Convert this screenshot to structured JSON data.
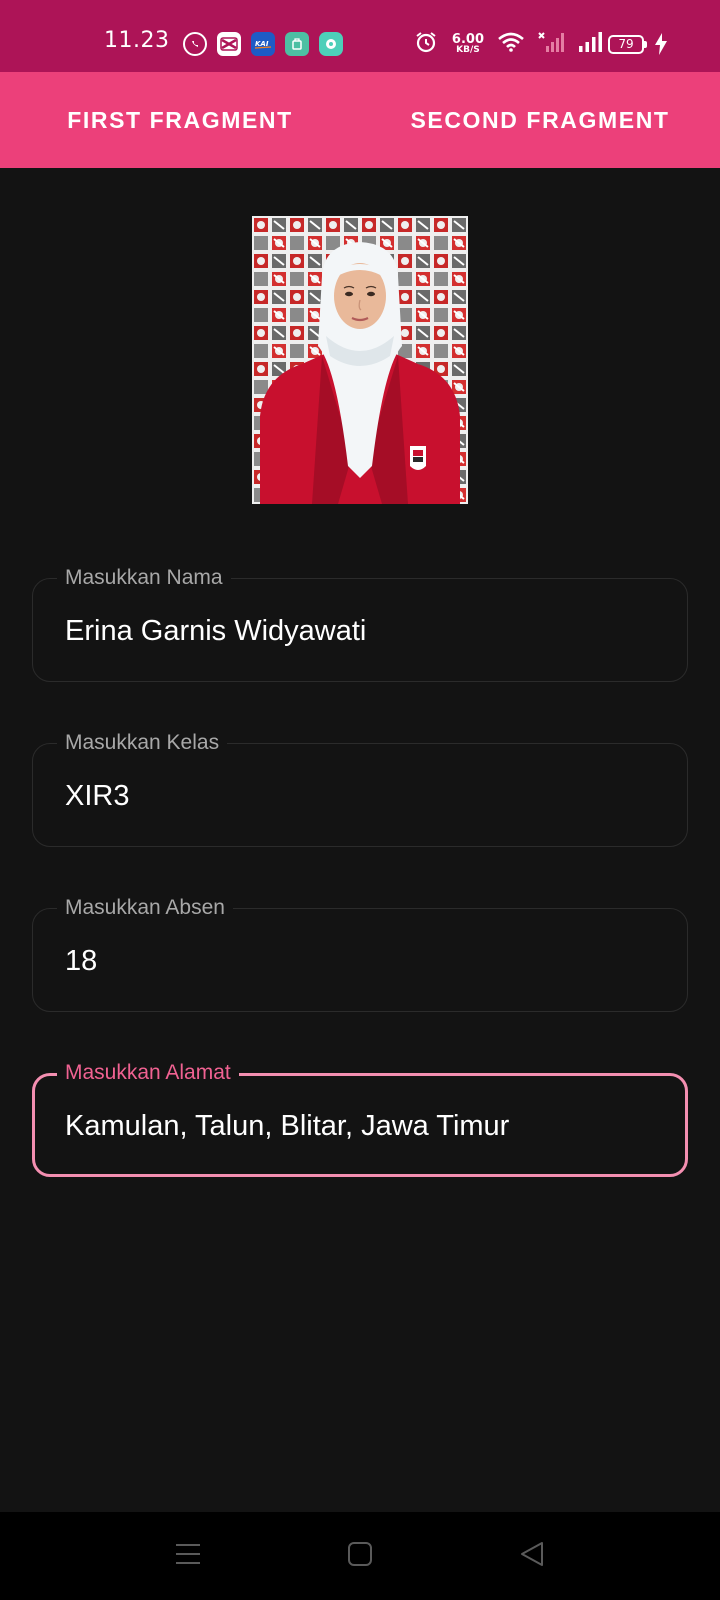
{
  "status_bar": {
    "time": "11.23",
    "net_speed_value": "6.00",
    "net_speed_unit": "KB/S",
    "battery": "79",
    "app_icons": [
      "whatsapp-icon",
      "capcut-icon",
      "kai-access-icon",
      "store-icon",
      "chat-icon"
    ],
    "system_icons": [
      "alarm-icon",
      "wifi-icon",
      "signal-no-service-icon",
      "signal-icon",
      "battery-icon",
      "charging-icon"
    ]
  },
  "tabs": [
    {
      "label": "FIRST FRAGMENT"
    },
    {
      "label": "SECOND FRAGMENT"
    }
  ],
  "form": {
    "fields": [
      {
        "label": "Masukkan Nama",
        "value": "Erina Garnis Widyawati"
      },
      {
        "label": "Masukkan Kelas",
        "value": "XIR3"
      },
      {
        "label": "Masukkan Absen",
        "value": "18"
      },
      {
        "label": "Masukkan Alamat",
        "value": "Kamulan, Talun, Blitar, Jawa Timur"
      }
    ],
    "focused_field": "Masukkan Alamat"
  },
  "nav_bar": {
    "buttons": [
      "menu-icon",
      "home-icon",
      "back-icon"
    ]
  },
  "colors": {
    "status_bar": "#ad1457",
    "tab_bar": "#ec407a",
    "background": "#131313",
    "focus_accent": "#f48fb1",
    "blazer_red": "#c8102e"
  }
}
